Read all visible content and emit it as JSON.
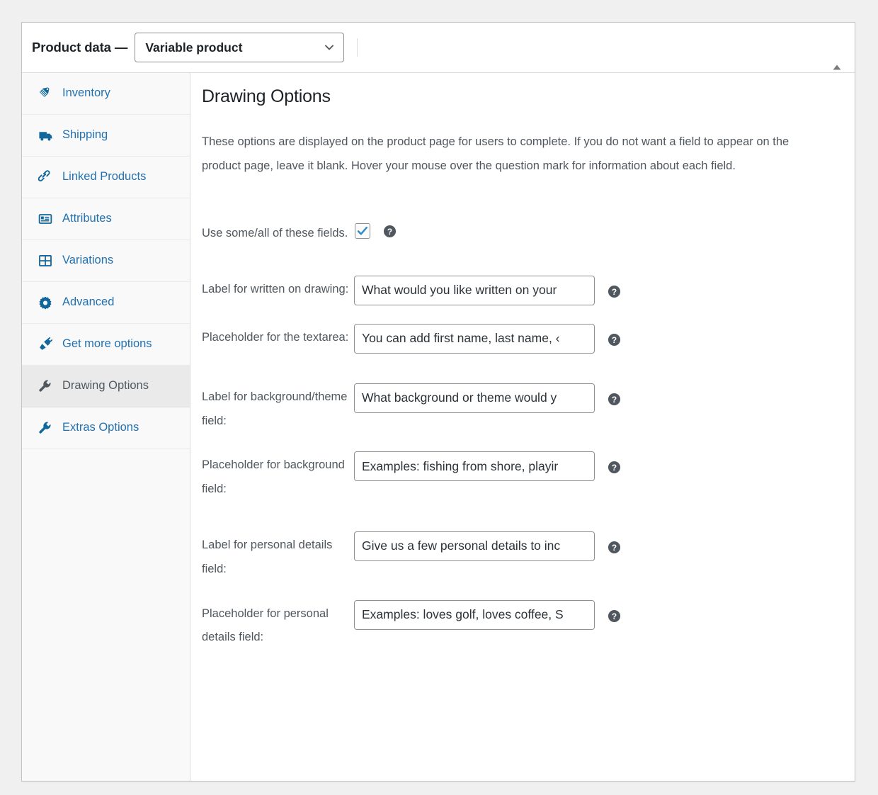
{
  "header": {
    "title": "Product data —",
    "product_type": "Variable product",
    "chevron_icon": "chevron-down-icon",
    "collapse_icon": "triangle-up-icon"
  },
  "sidebar": {
    "items": [
      {
        "label": "Inventory",
        "icon": "tags-icon",
        "active": false
      },
      {
        "label": "Shipping",
        "icon": "truck-icon",
        "active": false
      },
      {
        "label": "Linked Products",
        "icon": "link-icon",
        "active": false
      },
      {
        "label": "Attributes",
        "icon": "list-view-icon",
        "active": false
      },
      {
        "label": "Variations",
        "icon": "grid-icon",
        "active": false
      },
      {
        "label": "Advanced",
        "icon": "gear-icon",
        "active": false
      },
      {
        "label": "Get more options",
        "icon": "plugin-icon",
        "active": false
      },
      {
        "label": "Drawing Options",
        "icon": "wrench-icon",
        "active": true
      },
      {
        "label": "Extras Options",
        "icon": "wrench-icon",
        "active": false
      }
    ]
  },
  "main": {
    "title": "Drawing Options",
    "description": "These options are displayed on the product page for users to complete. If you do not want a field to appear on the product page, leave it blank. Hover your mouse over the question mark for information about each field.",
    "fields": [
      {
        "label": "Use some/all of these fields.",
        "type": "checkbox",
        "checked": true,
        "help_icon": "help-icon"
      },
      {
        "label": "Label for written on drawing:",
        "type": "text",
        "value": "What would you like written on your",
        "help_icon": "help-icon"
      },
      {
        "label": "Placeholder for the textarea:",
        "type": "text",
        "value": "You can add first name, last name, ‹",
        "help_icon": "help-icon"
      },
      {
        "label": "Label for background/theme field:",
        "type": "text",
        "value": "What background or theme would y",
        "help_icon": "help-icon"
      },
      {
        "label": "Placeholder for background field:",
        "type": "text",
        "value": "Examples: fishing from shore, playir",
        "help_icon": "help-icon"
      },
      {
        "label": "Label for personal details field:",
        "type": "text",
        "value": "Give us a few personal details to inc",
        "help_icon": "help-icon"
      },
      {
        "label": "Placeholder for personal details field:",
        "type": "text",
        "value": "Examples: loves golf, loves coffee, S",
        "help_icon": "help-icon"
      }
    ]
  },
  "colors": {
    "link": "#2271b1",
    "accent": "#2d89c8",
    "text": "#50575e",
    "heading": "#1d2327",
    "panel_border": "#c3c4c7",
    "sidebar_bg": "#f9f9f9",
    "active_tab_bg": "#eaeaea"
  }
}
